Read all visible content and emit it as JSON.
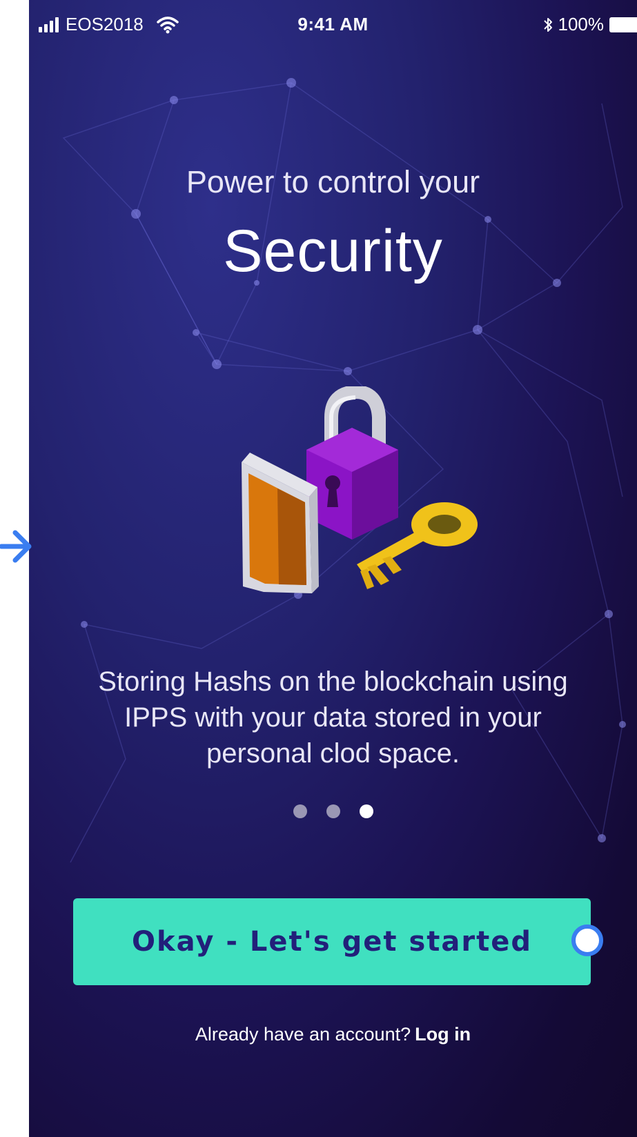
{
  "status_bar": {
    "carrier": "EOS2018",
    "time": "9:41 AM",
    "battery": "100%",
    "icons": [
      "signal-icon",
      "wifi-icon",
      "bluetooth-icon",
      "battery-icon"
    ]
  },
  "onboarding": {
    "subtitle": "Power to control your",
    "title": "Security",
    "description": "Storing Hashs on the blockchain using IPPS with your data stored in your personal clod space.",
    "illustration": [
      "shield-icon",
      "padlock-icon",
      "key-icon"
    ],
    "page_indicator": {
      "count": 3,
      "active_index": 2
    }
  },
  "cta": {
    "label": "Okay - Let's get started"
  },
  "login_prompt": {
    "text": "Already have an account?",
    "link": "Log in"
  },
  "colors": {
    "accent": "#40E0C0",
    "button_text": "#22207A",
    "background_top": "#2E2F8A",
    "background_bottom": "#12082C",
    "prototype_link": "#3A7DF0"
  }
}
